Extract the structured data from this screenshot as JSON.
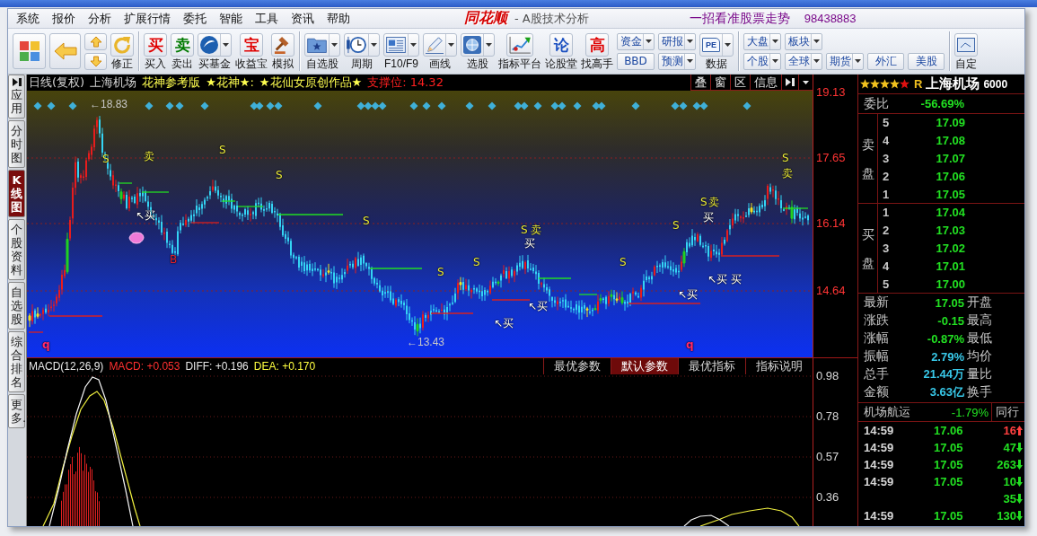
{
  "title_bar": {
    "menus": [
      {
        "label": "系统"
      },
      {
        "label": "报价"
      },
      {
        "label": "分析"
      },
      {
        "label": "扩展行情"
      },
      {
        "label": "委托"
      },
      {
        "label": "智能"
      },
      {
        "label": "工具"
      },
      {
        "label": "资讯"
      },
      {
        "label": "帮助"
      }
    ],
    "logo": "同花顺",
    "app_name": "- A股技术分析",
    "slogan": "一招看准股票走势",
    "phone": "98438883"
  },
  "toolbar": {
    "groups": [
      [
        {
          "kind": "icon",
          "label": "修正",
          "dropdown": false
        }
      ],
      [
        {
          "kind": "glyph",
          "glyph": "买",
          "color": "#e00000",
          "label": "买入",
          "dropdown": false
        },
        {
          "kind": "glyph",
          "glyph": "卖",
          "color": "#007a00",
          "label": "卖出",
          "dropdown": false
        },
        {
          "kind": "icon",
          "label": "买基金",
          "dropdown": true
        },
        {
          "kind": "glyph",
          "glyph": "宝",
          "color": "#e00000",
          "label": "收益宝",
          "dropdown": false
        },
        {
          "kind": "icon",
          "label": "模拟",
          "dropdown": false
        }
      ],
      [
        {
          "kind": "icon",
          "label": "自选股",
          "dropdown": true
        },
        {
          "kind": "icon",
          "label": "周期",
          "dropdown": true
        },
        {
          "kind": "icon",
          "label": "F10/F9",
          "dropdown": true
        },
        {
          "kind": "icon",
          "label": "画线",
          "dropdown": true
        },
        {
          "kind": "icon",
          "label": "选股",
          "dropdown": true
        },
        {
          "kind": "icon",
          "label": "指标平台",
          "dropdown": false
        },
        {
          "kind": "glyph",
          "glyph": "论",
          "color": "#1a4fc0",
          "label": "论股堂",
          "dropdown": false
        },
        {
          "kind": "glyph",
          "glyph": "高",
          "color": "#e00000",
          "label": "找高手",
          "dropdown": false
        },
        {
          "kind": "pair",
          "buttons": [
            {
              "label": "资金",
              "dropdown": true
            },
            {
              "label": "BBD",
              "dropdown": false
            }
          ]
        },
        {
          "kind": "pair",
          "buttons": [
            {
              "label": "研报",
              "dropdown": true
            },
            {
              "label": "预测",
              "dropdown": true
            }
          ]
        },
        {
          "kind": "document",
          "glyph": "PE",
          "label": "数据",
          "dropdown": true
        }
      ],
      [
        {
          "kind": "pair",
          "buttons": [
            {
              "label": "大盘",
              "dropdown": true
            },
            {
              "label": "个股",
              "dropdown": true
            }
          ]
        },
        {
          "kind": "pair",
          "buttons": [
            {
              "label": "板块",
              "dropdown": true
            },
            {
              "label": "全球",
              "dropdown": true
            }
          ]
        },
        {
          "kind": "pair",
          "buttons": [
            {
              "label": "期货",
              "dropdown": true
            }
          ]
        },
        {
          "kind": "pair",
          "buttons": [
            {
              "label": "外汇",
              "dropdown": false
            }
          ]
        },
        {
          "kind": "pair",
          "buttons": [
            {
              "label": "美股",
              "dropdown": false
            }
          ]
        }
      ],
      [
        {
          "kind": "icon",
          "label": "自定",
          "dropdown": false
        }
      ]
    ]
  },
  "sidebar": {
    "tabs": [
      {
        "label": "应用",
        "selected": false
      },
      {
        "label": "分时图",
        "selected": false
      },
      {
        "label": "K线图",
        "selected": true
      },
      {
        "label": "个股资料",
        "selected": false
      },
      {
        "label": "自选股",
        "selected": false
      },
      {
        "label": "综合排名",
        "selected": false
      },
      {
        "label": "更多.",
        "selected": false
      }
    ]
  },
  "chart": {
    "title_parts": [
      {
        "text": "日线(复权)",
        "kind": "plain"
      },
      {
        "text": "上海机场",
        "kind": "plain"
      },
      {
        "text": "花神参考版",
        "kind": "highlight"
      },
      {
        "text": "★花神★:",
        "kind": "highlight"
      },
      {
        "text": "★花仙女原创作品★",
        "kind": "highlight"
      },
      {
        "text": "支撑位: 14.32",
        "kind": "alert"
      }
    ],
    "tools": [
      {
        "label": "叠"
      },
      {
        "label": "窗"
      },
      {
        "label": "区"
      },
      {
        "label": "信息"
      }
    ],
    "price_axis": [
      "19.13",
      "17.65",
      "16.14",
      "14.64"
    ],
    "high": "←18.83",
    "low": "←13.43",
    "signals": [
      {
        "text": "q",
        "kind": "cycle"
      },
      {
        "text": "S",
        "kind": "sell"
      },
      {
        "text": "↖买",
        "kind": "buy"
      },
      {
        "text": "卖",
        "kind": "sell"
      },
      {
        "text": "B",
        "kind": "bottom"
      },
      {
        "text": "S",
        "kind": "sell"
      },
      {
        "text": "S",
        "kind": "sell"
      },
      {
        "text": "S",
        "kind": "sell"
      },
      {
        "text": "S",
        "kind": "sell"
      },
      {
        "text": "S",
        "kind": "sell"
      },
      {
        "text": "↖买",
        "kind": "buy"
      },
      {
        "text": "S",
        "kind": "sell"
      },
      {
        "text": "买",
        "kind": "buy"
      },
      {
        "text": "↖买",
        "kind": "buy"
      },
      {
        "text": "卖",
        "kind": "sell"
      },
      {
        "text": "S",
        "kind": "sell"
      },
      {
        "text": "S",
        "kind": "sell"
      },
      {
        "text": "↖买",
        "kind": "buy"
      },
      {
        "text": "q",
        "kind": "cycle"
      },
      {
        "text": "S",
        "kind": "sell"
      },
      {
        "text": "买",
        "kind": "buy"
      },
      {
        "text": "↖买",
        "kind": "buy"
      },
      {
        "text": "卖",
        "kind": "sell"
      },
      {
        "text": "买",
        "kind": "buy"
      },
      {
        "text": "S",
        "kind": "sell"
      },
      {
        "text": "卖",
        "kind": "sell"
      }
    ]
  },
  "indicator": {
    "name": "MACD(12,26,9)",
    "readouts": [
      {
        "text": "MACD: +0.053",
        "color": "#ff3030"
      },
      {
        "text": "DIFF: +0.196",
        "color": "#e8e8e8"
      },
      {
        "text": "DEA: +0.170",
        "color": "#ffff40"
      }
    ],
    "tabs": [
      {
        "label": "最优参数",
        "selected": false
      },
      {
        "label": "默认参数",
        "selected": true
      },
      {
        "label": "最优指标",
        "selected": false
      },
      {
        "label": "指标说明",
        "selected": false
      }
    ],
    "axis": [
      "0.98",
      "0.78",
      "0.57",
      "0.36"
    ]
  },
  "quote": {
    "stars": 4,
    "grade": "R",
    "name": "上海机场",
    "code": "6000",
    "ratio": {
      "label": "委比",
      "value": "-56.69%"
    },
    "asks": {
      "label": "卖盘",
      "levels": [
        {
          "index": "5",
          "price": "17.09"
        },
        {
          "index": "4",
          "price": "17.08"
        },
        {
          "index": "3",
          "price": "17.07"
        },
        {
          "index": "2",
          "price": "17.06"
        },
        {
          "index": "1",
          "price": "17.05"
        }
      ]
    },
    "bids": {
      "label": "买盘",
      "levels": [
        {
          "index": "1",
          "price": "17.04"
        },
        {
          "index": "2",
          "price": "17.03"
        },
        {
          "index": "3",
          "price": "17.02"
        },
        {
          "index": "4",
          "price": "17.01"
        },
        {
          "index": "5",
          "price": "17.00"
        }
      ]
    },
    "stats": [
      {
        "label": "最新",
        "value": "17.05",
        "color": "#22e022",
        "label_2": "开盘"
      },
      {
        "label": "涨跌",
        "value": "-0.15",
        "color": "#22e022",
        "label_2": "最高"
      },
      {
        "label": "涨幅",
        "value": "-0.87%",
        "color": "#22e022",
        "label_2": "最低"
      },
      {
        "label": "振幅",
        "value": "2.79%",
        "color": "#38c8e8",
        "label_2": "均价"
      },
      {
        "label": "总手",
        "value": "21.44万",
        "color": "#38c8e8",
        "label_2": "量比"
      },
      {
        "label": "金额",
        "value": "3.63亿",
        "color": "#38c8e8",
        "label_2": "换手"
      }
    ],
    "sector": {
      "name": "机场航运",
      "change": "-1.79%",
      "peer": "同行"
    },
    "ticks": [
      {
        "time": "14:59",
        "price": "17.06",
        "volume": "16",
        "rising": true
      },
      {
        "time": "14:59",
        "price": "17.05",
        "volume": "47",
        "rising": false
      },
      {
        "time": "14:59",
        "price": "17.05",
        "volume": "263",
        "rising": false
      },
      {
        "time": "14:59",
        "price": "17.05",
        "volume": "10",
        "rising": false
      },
      {
        "volume": "35",
        "rising": false
      },
      {
        "time": "14:59",
        "price": "17.05",
        "volume": "130",
        "rising": false
      }
    ]
  }
}
